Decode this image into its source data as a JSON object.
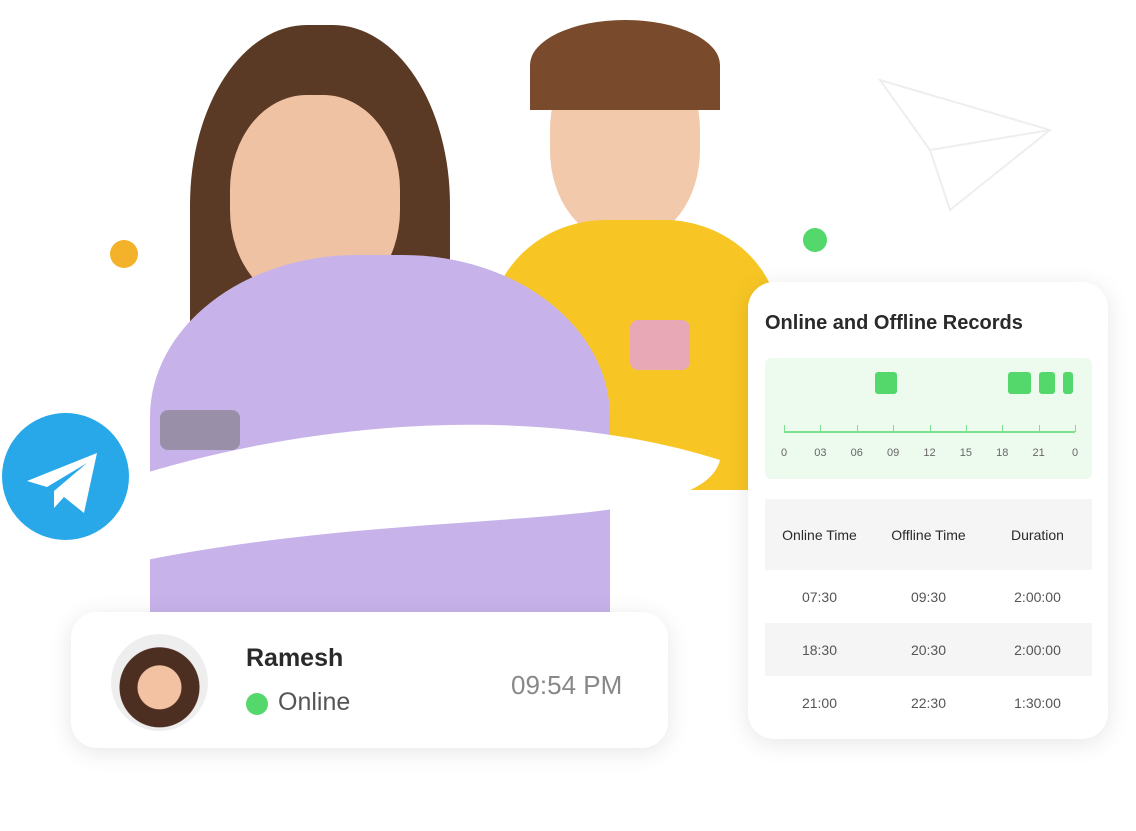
{
  "colors": {
    "accent_green": "#55d86b",
    "telegram_blue": "#28a8e9",
    "timeline_bg": "#edfaee",
    "dot_yellow": "#f4b22a"
  },
  "icons": {
    "telegram": "telegram-paper-plane-icon",
    "status": "online-dot-icon"
  },
  "records": {
    "title": "Online and Offline Records",
    "timeline": {
      "tick_labels": [
        "0",
        "03",
        "06",
        "09",
        "12",
        "15",
        "18",
        "21",
        "0"
      ],
      "online_segments_hours": [
        [
          7.5,
          9.5
        ],
        [
          18.5,
          20.5
        ],
        [
          21,
          22.5
        ],
        [
          23,
          24
        ]
      ]
    },
    "columns": [
      "Online Time",
      "Offline Time",
      "Duration"
    ],
    "rows": [
      [
        "07:30",
        "09:30",
        "2:00:00"
      ],
      [
        "18:30",
        "20:30",
        "2:00:00"
      ],
      [
        "21:00",
        "22:30",
        "1:30:00"
      ]
    ]
  },
  "status_card": {
    "name": "Ramesh",
    "status": "Online",
    "time": "09:54 PM"
  }
}
